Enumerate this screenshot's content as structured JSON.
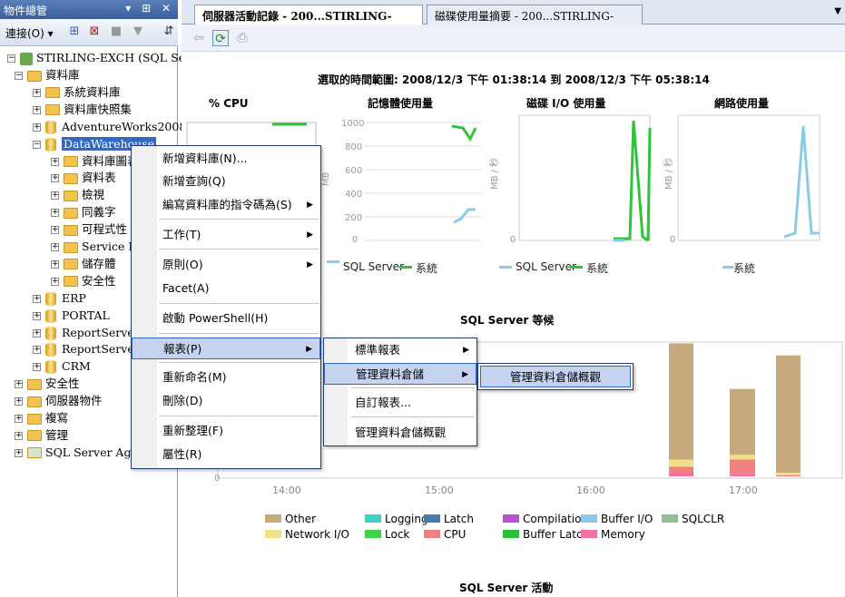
{
  "object_explorer": {
    "title": "物件總管",
    "title_buttons": "▾ ⊞ ✕",
    "connect_label": "連接(O)",
    "root": "STIRLING-EXCH (SQL Serv",
    "items": [
      {
        "label": "資料庫",
        "exp": "−",
        "indent": 0
      },
      {
        "label": "系統資料庫",
        "exp": "+",
        "indent": 1
      },
      {
        "label": "資料庫快照集",
        "exp": "+",
        "indent": 1
      },
      {
        "label": "AdventureWorks2008",
        "exp": "+",
        "indent": 1,
        "db": true
      },
      {
        "label": "DataWarehouse",
        "exp": "−",
        "indent": 1,
        "db": true,
        "selected": true
      },
      {
        "label": "資料庫圖表",
        "exp": "+",
        "indent": 2
      },
      {
        "label": "資料表",
        "exp": "+",
        "indent": 2
      },
      {
        "label": "檢視",
        "exp": "+",
        "indent": 2
      },
      {
        "label": "同義字",
        "exp": "+",
        "indent": 2
      },
      {
        "label": "可程式性",
        "exp": "+",
        "indent": 2
      },
      {
        "label": "Service Bro",
        "exp": "+",
        "indent": 2
      },
      {
        "label": "儲存體",
        "exp": "+",
        "indent": 2
      },
      {
        "label": "安全性",
        "exp": "+",
        "indent": 2
      },
      {
        "label": "ERP",
        "exp": "+",
        "indent": 1,
        "db": true
      },
      {
        "label": "PORTAL",
        "exp": "+",
        "indent": 1,
        "db": true
      },
      {
        "label": "ReportServer",
        "exp": "+",
        "indent": 1,
        "db": true
      },
      {
        "label": "ReportServerTe",
        "exp": "+",
        "indent": 1,
        "db": true
      },
      {
        "label": "CRM",
        "exp": "+",
        "indent": 1,
        "db": true
      },
      {
        "label": "安全性",
        "exp": "+",
        "indent": 0
      },
      {
        "label": "伺服器物件",
        "exp": "+",
        "indent": 0
      },
      {
        "label": "複寫",
        "exp": "+",
        "indent": 0
      },
      {
        "label": "管理",
        "exp": "+",
        "indent": 0
      },
      {
        "label": "SQL Server Agent",
        "exp": "+",
        "indent": 0,
        "agent": true
      }
    ]
  },
  "tabs": [
    {
      "label": "伺服器活動記錄 - 200...STIRLING-EXCH",
      "active": true
    },
    {
      "label": "磁碟使用量摘要 - 200...STIRLING-EXCH",
      "active": false
    }
  ],
  "report": {
    "time_range": "選取的時間範圍: 2008/12/3 下午 01:38:14 到 2008/12/3 下午 05:38:14",
    "cpu_title": "% CPU",
    "mem_title": "記憶體使用量",
    "disk_title": "磁碟 I/O 使用量",
    "net_title": "網路使用量",
    "mem_ticks": [
      "1000",
      "800",
      "600",
      "400",
      "200",
      "0"
    ],
    "mb_axis": "MB",
    "mbps_axis": "MB / 秒",
    "zero": "0",
    "legend_sql": "SQL Server",
    "legend_sys": "系統",
    "waits_title": "SQL Server 等候",
    "wait_times": [
      "14:00",
      "15:00",
      "16:00",
      "17:00"
    ],
    "wait_legend": [
      {
        "name": "Other",
        "color": "#c8a97e"
      },
      {
        "name": "Logging",
        "color": "#3fd1c8"
      },
      {
        "name": "Latch",
        "color": "#4a7aaa"
      },
      {
        "name": "Compilation",
        "color": "#b452d1"
      },
      {
        "name": "Buffer I/O",
        "color": "#8fc8e6"
      },
      {
        "name": "SQLCLR",
        "color": "#8fbf93"
      },
      {
        "name": "Network I/O",
        "color": "#f0e08a"
      },
      {
        "name": "Lock",
        "color": "#3dd44a"
      },
      {
        "name": "CPU",
        "color": "#f08080"
      },
      {
        "name": "Buffer Latch",
        "color": "#2bbf3a"
      },
      {
        "name": "Memory",
        "color": "#f26fa8"
      }
    ],
    "activity_title": "SQL Server 活動"
  },
  "context_menu": {
    "items": [
      "新增資料庫(N)...",
      "新增查詢(Q)",
      "編寫資料庫的指令碼為(S)",
      "工作(T)",
      "原則(O)",
      "Facet(A)",
      "啟動 PowerShell(H)",
      "報表(P)",
      "重新命名(M)",
      "刪除(D)",
      "重新整理(F)",
      "屬性(R)"
    ]
  },
  "reports_submenu": {
    "items": [
      "標準報表",
      "管理資料倉儲",
      "自訂報表...",
      "管理資料倉儲概觀"
    ]
  },
  "dw_submenu": {
    "items": [
      "管理資料倉儲概觀"
    ]
  },
  "chart_data": [
    {
      "type": "line",
      "title": "% CPU",
      "series": []
    },
    {
      "type": "line",
      "title": "記憶體使用量",
      "ylabel": "MB",
      "ylim": [
        0,
        1000
      ],
      "series": [
        {
          "name": "SQL Server",
          "values": [
            60,
            100,
            250,
            240
          ]
        },
        {
          "name": "系統",
          "values": [
            940,
            930,
            870,
            940
          ]
        }
      ]
    },
    {
      "type": "line",
      "title": "磁碟 I/O 使用量",
      "ylabel": "MB / 秒",
      "series": [
        {
          "name": "SQL Server",
          "values": [
            0,
            0,
            0,
            0
          ]
        },
        {
          "name": "系統",
          "values": [
            0,
            0.05,
            0.93,
            0.05,
            0.87
          ]
        }
      ]
    },
    {
      "type": "line",
      "title": "網路使用量",
      "ylabel": "MB / 秒",
      "series": [
        {
          "name": "系統",
          "values": [
            0,
            0.05,
            0.97,
            0.06
          ]
        }
      ]
    },
    {
      "type": "bar",
      "title": "SQL Server 等候",
      "categories": [
        "14:00",
        "15:00",
        "16:00",
        "17:00"
      ],
      "stacks": [
        {
          "Other": 0.97,
          "Network I/O": 0.06,
          "CPU": 0.05,
          "Memory": 0.03
        },
        {
          "Other": 0.55,
          "Network I/O": 0.04,
          "CPU": 0.12,
          "Memory": 0.02
        },
        {
          "Other": 0.98,
          "Network I/O": 0.02,
          "CPU": 0.01
        }
      ]
    }
  ]
}
